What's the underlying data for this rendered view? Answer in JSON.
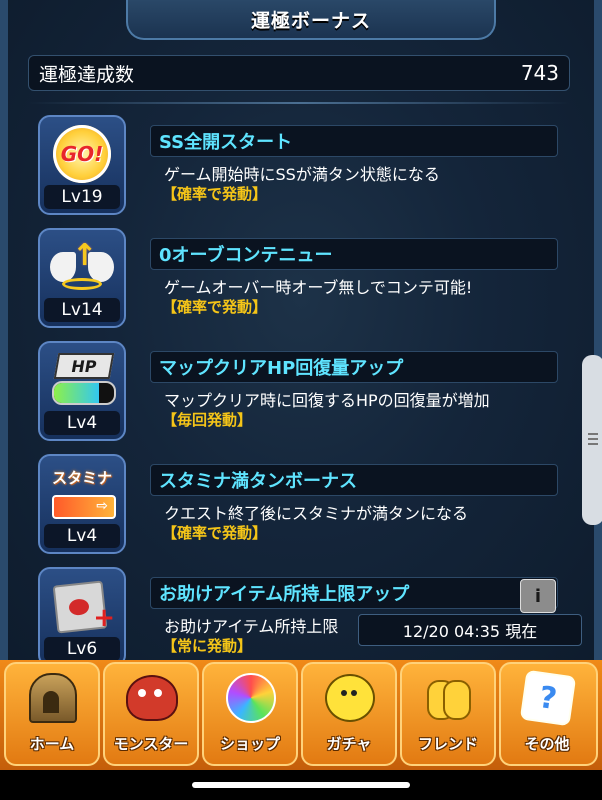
{
  "header": {
    "title": "運極ボーナス"
  },
  "summary": {
    "label": "運極達成数",
    "value": "743"
  },
  "bonuses": [
    {
      "level": "Lv19",
      "title": "SS全開スタート",
      "description": "ゲーム開始時にSSが満タン状態になる",
      "trigger": "【確率で発動】",
      "icon": "go-icon",
      "icon_text": "GO!"
    },
    {
      "level": "Lv14",
      "title": "0オーブコンテニュー",
      "description": "ゲームオーバー時オーブ無しでコンテ可能!",
      "trigger": "【確率で発動】",
      "icon": "winged-arrow-icon"
    },
    {
      "level": "Lv4",
      "title": "マップクリアHP回復量アップ",
      "description": "マップクリア時に回復するHPの回復量が増加",
      "trigger": "【毎回発動】",
      "icon": "hp-gauge-icon",
      "icon_text": "HP"
    },
    {
      "level": "Lv4",
      "title": "スタミナ満タンボーナス",
      "description": "クエスト終了後にスタミナが満タンになる",
      "trigger": "【確率で発動】",
      "icon": "stamina-gauge-icon",
      "icon_text": "スタミナ"
    },
    {
      "level": "Lv6",
      "title": "お助けアイテム所持上限アップ",
      "description": "お助けアイテム所持上限",
      "trigger": "【常に発動】",
      "icon": "item-card-icon"
    }
  ],
  "info_button": {
    "label": "i"
  },
  "timestamp": "12/20 04:35 現在",
  "nav": [
    {
      "label": "ホーム",
      "icon": "home-icon"
    },
    {
      "label": "モンスター",
      "icon": "monster-icon"
    },
    {
      "label": "ショップ",
      "icon": "rainbow-orb-icon"
    },
    {
      "label": "ガチャ",
      "icon": "gacha-icon"
    },
    {
      "label": "フレンド",
      "icon": "friend-icon"
    },
    {
      "label": "その他",
      "icon": "other-icon",
      "icon_text": "?"
    }
  ]
}
